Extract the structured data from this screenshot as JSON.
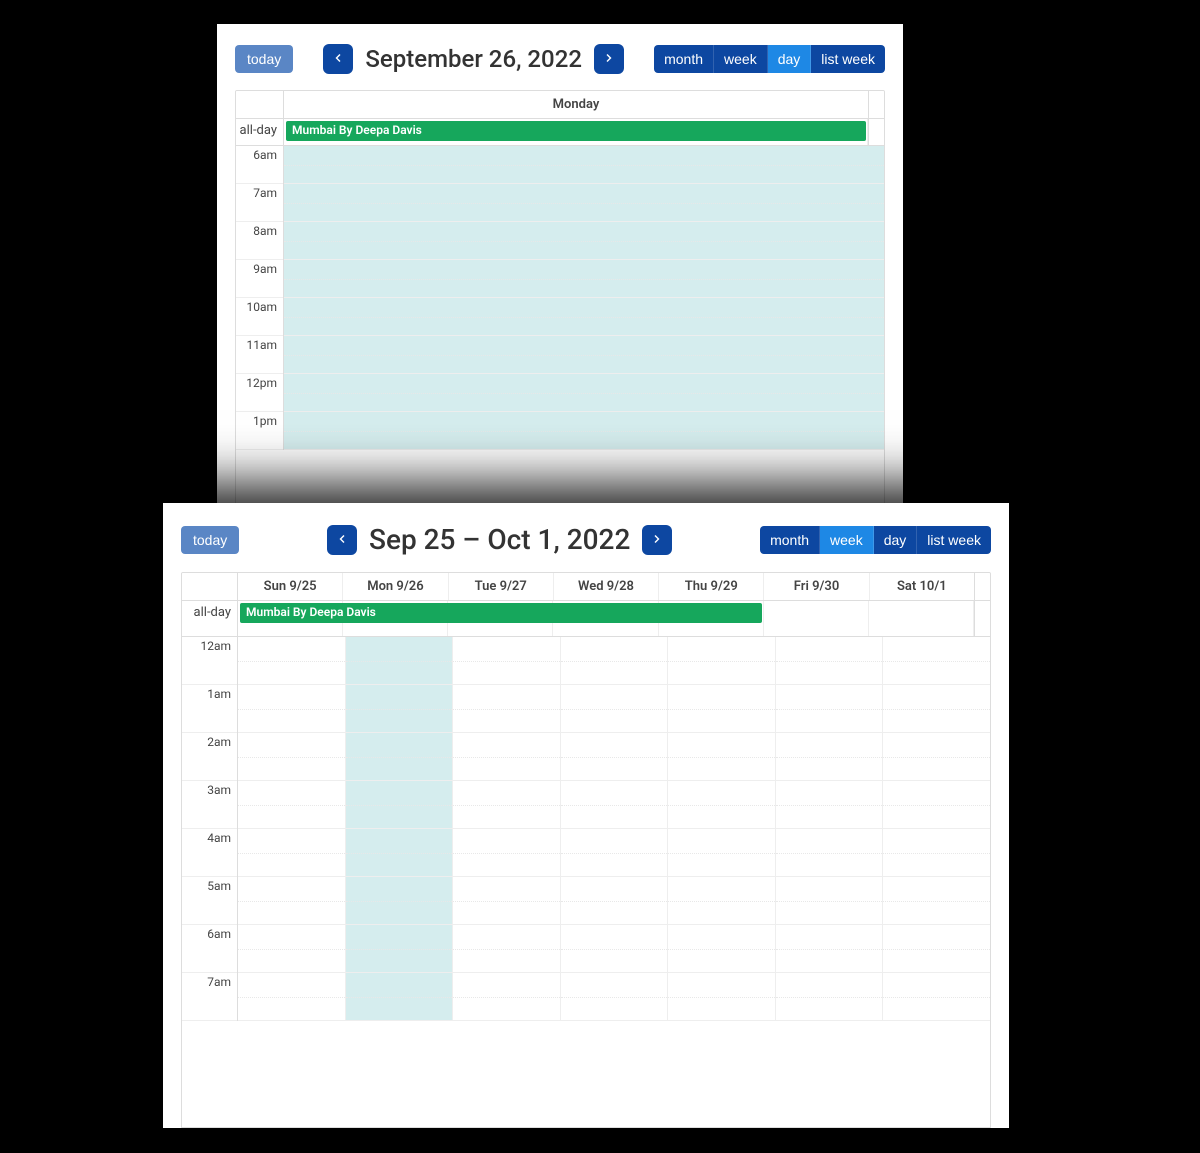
{
  "panel1": {
    "today_label": "today",
    "title": "September 26, 2022",
    "views": {
      "month": "month",
      "week": "week",
      "day": "day",
      "list": "list week"
    },
    "active_view": "day",
    "day_header": "Monday",
    "allday_label": "all-day",
    "event_title": "Mumbai By Deepa Davis",
    "time_slots": [
      "6am",
      "7am",
      "8am",
      "9am",
      "10am",
      "11am",
      "12pm",
      "1pm"
    ]
  },
  "panel2": {
    "today_label": "today",
    "title": "Sep 25 – Oct 1, 2022",
    "views": {
      "month": "month",
      "week": "week",
      "day": "day",
      "list": "list week"
    },
    "active_view": "week",
    "day_headers": [
      "Sun 9/25",
      "Mon 9/26",
      "Tue 9/27",
      "Wed 9/28",
      "Thu 9/29",
      "Fri 9/30",
      "Sat 10/1"
    ],
    "allday_label": "all-day",
    "event_title": "Mumbai By Deepa Davis",
    "event_span_cols": 5,
    "highlight_col_index": 1,
    "time_slots": [
      "12am",
      "1am",
      "2am",
      "3am",
      "4am",
      "5am",
      "6am",
      "7am"
    ]
  }
}
